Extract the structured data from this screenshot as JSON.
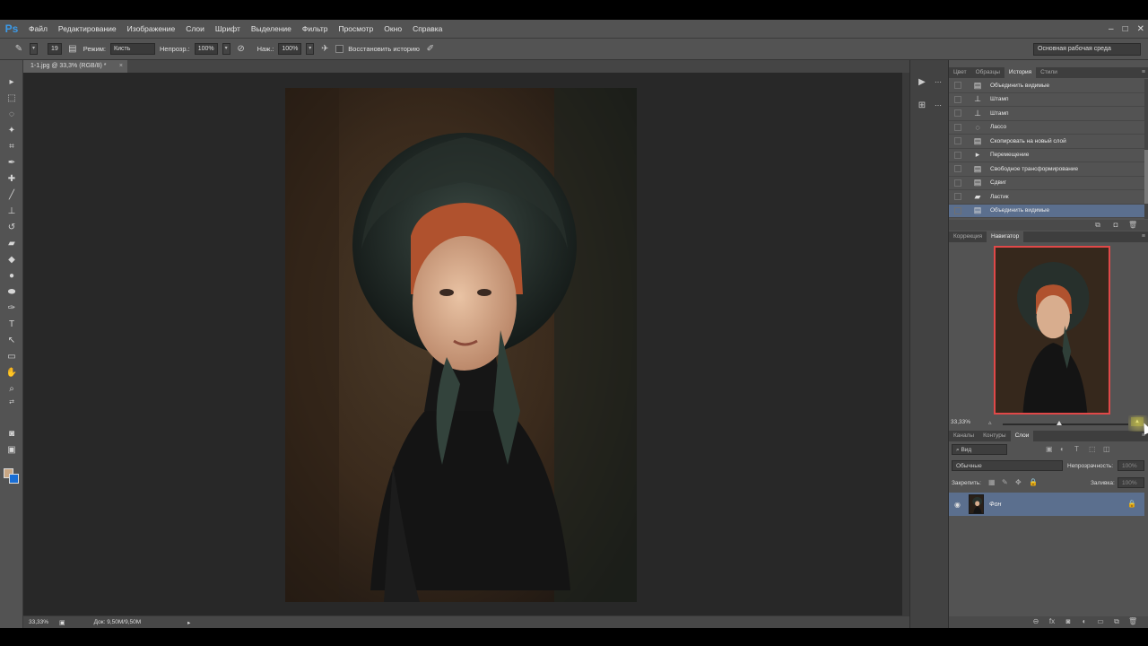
{
  "app": {
    "logo": "Ps"
  },
  "menu": [
    "Файл",
    "Редактирование",
    "Изображение",
    "Слои",
    "Шрифт",
    "Выделение",
    "Фильтр",
    "Просмотр",
    "Окно",
    "Справка"
  ],
  "window_controls": {
    "minimize": "–",
    "maximize": "□",
    "close": "✕"
  },
  "options": {
    "brush_size": "19",
    "mode_label": "Режим:",
    "mode_value": "Кисть",
    "opacity_label": "Непрозр.:",
    "opacity_value": "100%",
    "pressure_label": "Наж.:",
    "pressure_value": "100%",
    "restore_history_label": "Восстановить историю",
    "workspace": "Основная рабочая среда"
  },
  "document": {
    "tab_title": "1-1.jpg @ 33,3% (RGB/8) *",
    "tab_close": "×"
  },
  "status": {
    "zoom": "33,33%",
    "doc_size": "Док: 9,50M/9,50M"
  },
  "history_panel": {
    "tabs": [
      "Цвет",
      "Образцы",
      "История",
      "Стили"
    ],
    "active_tab": 2,
    "items": [
      {
        "label": "Объединить видимые",
        "icon": "doc-icon"
      },
      {
        "label": "Штамп",
        "icon": "stamp-icon"
      },
      {
        "label": "Штамп",
        "icon": "stamp-icon"
      },
      {
        "label": "Лассо",
        "icon": "lasso-icon"
      },
      {
        "label": "Скопировать на новый слой",
        "icon": "doc-icon"
      },
      {
        "label": "Перемещение",
        "icon": "move-icon"
      },
      {
        "label": "Свободное трансформирование",
        "icon": "doc-icon"
      },
      {
        "label": "Сдвиг",
        "icon": "doc-icon"
      },
      {
        "label": "Ластик",
        "icon": "eraser-icon"
      },
      {
        "label": "Объединить видимые",
        "icon": "doc-icon"
      }
    ],
    "selected_index": 9
  },
  "navigator_panel": {
    "tabs": [
      "Коррекция",
      "Навигатор"
    ],
    "active_tab": 1,
    "zoom": "33,33%",
    "zoom_slider_fraction": 0.45
  },
  "layers_panel": {
    "tabs": [
      "Каналы",
      "Контуры",
      "Слои"
    ],
    "active_tab": 2,
    "filter_kind": "Вид",
    "blend_mode": "Обычные",
    "opacity_label": "Непрозрачность:",
    "opacity_value": "100%",
    "lock_label": "Закрепить:",
    "fill_label": "Заливка:",
    "fill_value": "100%",
    "layers": [
      {
        "name": "Фон",
        "visible": true,
        "locked": true
      }
    ]
  },
  "colors": {
    "foreground": "#c9a784",
    "background": "#1a6ed4",
    "accent": "#5b6f8e",
    "logo": "#3c9ae8"
  }
}
